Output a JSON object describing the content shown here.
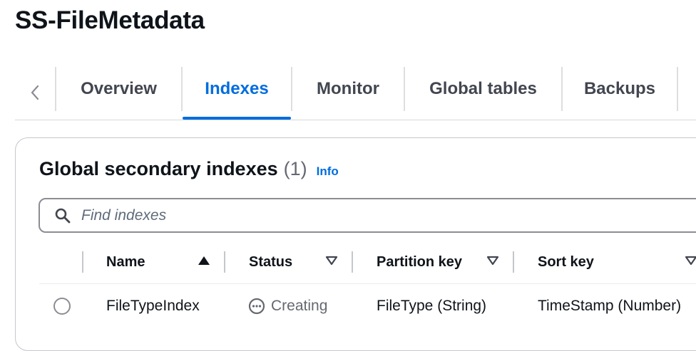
{
  "page": {
    "title": "SS-FileMetadata"
  },
  "tabs": {
    "prev_icon": "chevron-left-icon",
    "items": [
      {
        "label": "Overview",
        "active": false
      },
      {
        "label": "Indexes",
        "active": true
      },
      {
        "label": "Monitor",
        "active": false
      },
      {
        "label": "Global tables",
        "active": false
      },
      {
        "label": "Backups",
        "active": false
      }
    ]
  },
  "gsi": {
    "title": "Global secondary indexes",
    "count": "(1)",
    "info_label": "Info",
    "search": {
      "placeholder": "Find indexes",
      "value": "",
      "icon": "search-icon"
    },
    "columns": [
      {
        "label": "Name",
        "sort": "ascending"
      },
      {
        "label": "Status",
        "sort": "sortable"
      },
      {
        "label": "Partition key",
        "sort": "sortable"
      },
      {
        "label": "Sort key",
        "sort": "sortable"
      }
    ],
    "rows": [
      {
        "selected": false,
        "name": "FileTypeIndex",
        "status": "Creating",
        "status_icon": "in-progress-icon",
        "partition_key": "FileType (String)",
        "sort_key": "TimeStamp (Number)"
      }
    ]
  },
  "colors": {
    "accent": "#006ce0",
    "text": "#0f141a",
    "tab_text": "#424650",
    "muted": "#656871",
    "border": "#8c8c94"
  }
}
